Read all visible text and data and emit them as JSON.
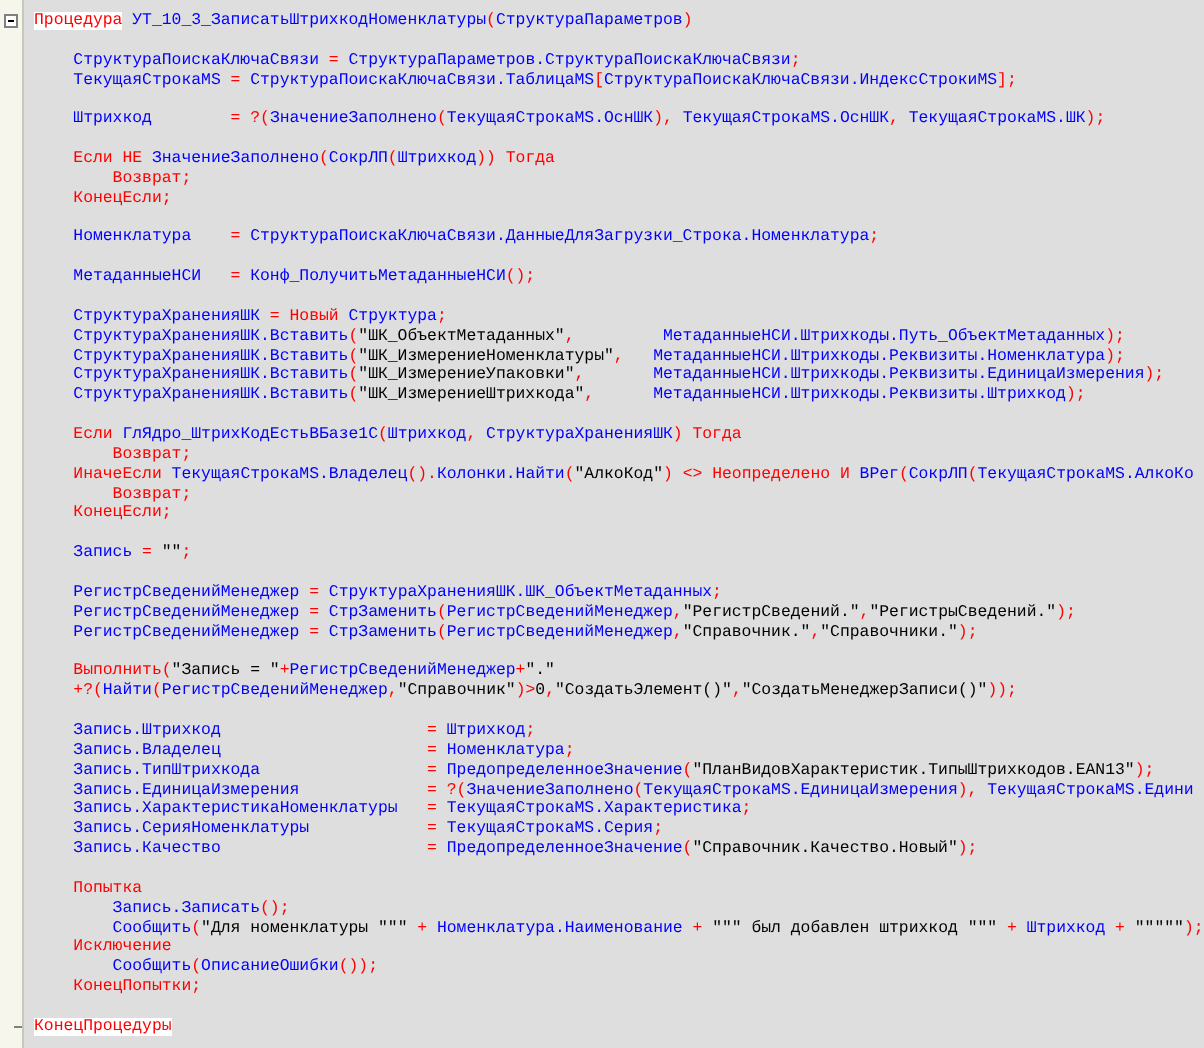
{
  "editor": {
    "lines": [
      {
        "kind": "procedure_start",
        "tokens": [
          {
            "kind": "marked_keyword",
            "text": "Процедура"
          },
          {
            "kind": "name",
            "text": " УТ_10_3_ЗаписатьШтрихкодНоменклатуры"
          },
          {
            "kind": "operator",
            "text": "("
          },
          {
            "kind": "name",
            "text": "СтруктураПараметров"
          },
          {
            "kind": "operator",
            "text": ")"
          }
        ]
      },
      {
        "kind": "blank"
      },
      {
        "kind": "code",
        "tokens": [
          {
            "kind": "name",
            "text": "    СтруктураПоискаКлючаСвязи"
          },
          {
            "kind": "operator",
            "text": " = "
          },
          {
            "kind": "name",
            "text": "СтруктураПараметров.СтруктураПоискаКлючаСвязи"
          },
          {
            "kind": "operator",
            "text": ";"
          }
        ]
      },
      {
        "kind": "code",
        "tokens": [
          {
            "kind": "name",
            "text": "    ТекущаяСтрокаMS"
          },
          {
            "kind": "operator",
            "text": " = "
          },
          {
            "kind": "name",
            "text": "СтруктураПоискаКлючаСвязи.ТаблицаMS"
          },
          {
            "kind": "operator",
            "text": "["
          },
          {
            "kind": "name",
            "text": "СтруктураПоискаКлючаСвязи.ИндексСтрокиMS"
          },
          {
            "kind": "operator",
            "text": "];"
          }
        ]
      },
      {
        "kind": "blank"
      },
      {
        "kind": "code",
        "tokens": [
          {
            "kind": "name",
            "text": "    Штрихкод"
          },
          {
            "kind": "operator",
            "text": "        = ?("
          },
          {
            "kind": "name",
            "text": "ЗначениеЗаполнено"
          },
          {
            "kind": "operator",
            "text": "("
          },
          {
            "kind": "name",
            "text": "ТекущаяСтрокаMS.ОснШК"
          },
          {
            "kind": "operator",
            "text": "), "
          },
          {
            "kind": "name",
            "text": "ТекущаяСтрокаMS.ОснШК"
          },
          {
            "kind": "operator",
            "text": ", "
          },
          {
            "kind": "name",
            "text": "ТекущаяСтрокаMS.ШК"
          },
          {
            "kind": "operator",
            "text": ");"
          }
        ]
      },
      {
        "kind": "blank"
      },
      {
        "kind": "code",
        "tokens": [
          {
            "kind": "keyword",
            "text": "    Если НЕ "
          },
          {
            "kind": "name",
            "text": "ЗначениеЗаполнено"
          },
          {
            "kind": "operator",
            "text": "("
          },
          {
            "kind": "name",
            "text": "СокрЛП"
          },
          {
            "kind": "operator",
            "text": "("
          },
          {
            "kind": "name",
            "text": "Штрихкод"
          },
          {
            "kind": "operator",
            "text": ")) "
          },
          {
            "kind": "keyword",
            "text": "Тогда"
          }
        ]
      },
      {
        "kind": "code",
        "tokens": [
          {
            "kind": "keyword",
            "text": "        Возврат;"
          }
        ]
      },
      {
        "kind": "code",
        "tokens": [
          {
            "kind": "keyword",
            "text": "    КонецЕсли;"
          }
        ]
      },
      {
        "kind": "blank"
      },
      {
        "kind": "code",
        "tokens": [
          {
            "kind": "name",
            "text": "    Номенклатура"
          },
          {
            "kind": "operator",
            "text": "    = "
          },
          {
            "kind": "name",
            "text": "СтруктураПоискаКлючаСвязи.ДанныеДляЗагрузки_Строка.Номенклатура"
          },
          {
            "kind": "operator",
            "text": ";"
          }
        ]
      },
      {
        "kind": "blank"
      },
      {
        "kind": "code",
        "tokens": [
          {
            "kind": "name",
            "text": "    МетаданныеНСИ"
          },
          {
            "kind": "operator",
            "text": "   = "
          },
          {
            "kind": "name",
            "text": "Конф_ПолучитьМетаданныеНСИ"
          },
          {
            "kind": "operator",
            "text": "();"
          }
        ]
      },
      {
        "kind": "blank"
      },
      {
        "kind": "code",
        "tokens": [
          {
            "kind": "name",
            "text": "    СтруктураХраненияШК"
          },
          {
            "kind": "operator",
            "text": " = "
          },
          {
            "kind": "keyword",
            "text": "Новый "
          },
          {
            "kind": "name",
            "text": "Структура"
          },
          {
            "kind": "operator",
            "text": ";"
          }
        ]
      },
      {
        "kind": "code",
        "tokens": [
          {
            "kind": "name",
            "text": "    СтруктураХраненияШК.Вставить"
          },
          {
            "kind": "operator",
            "text": "("
          },
          {
            "kind": "string",
            "text": "\"ШК_ОбъектМетаданных\""
          },
          {
            "kind": "operator",
            "text": ",         "
          },
          {
            "kind": "name",
            "text": "МетаданныеНСИ.Штрихкоды.Путь_ОбъектМетаданных"
          },
          {
            "kind": "operator",
            "text": ");"
          }
        ]
      },
      {
        "kind": "code",
        "tokens": [
          {
            "kind": "name",
            "text": "    СтруктураХраненияШК.Вставить"
          },
          {
            "kind": "operator",
            "text": "("
          },
          {
            "kind": "string",
            "text": "\"ШК_ИзмерениеНоменклатуры\""
          },
          {
            "kind": "operator",
            "text": ",   "
          },
          {
            "kind": "name",
            "text": "МетаданныеНСИ.Штрихкоды.Реквизиты.Номенклатура"
          },
          {
            "kind": "operator",
            "text": ");"
          }
        ]
      },
      {
        "kind": "code",
        "tokens": [
          {
            "kind": "name",
            "text": "    СтруктураХраненияШК.Вставить"
          },
          {
            "kind": "operator",
            "text": "("
          },
          {
            "kind": "string",
            "text": "\"ШК_ИзмерениеУпаковки\""
          },
          {
            "kind": "operator",
            "text": ",       "
          },
          {
            "kind": "name",
            "text": "МетаданныеНСИ.Штрихкоды.Реквизиты.ЕдиницаИзмерения"
          },
          {
            "kind": "operator",
            "text": ");"
          }
        ]
      },
      {
        "kind": "code",
        "tokens": [
          {
            "kind": "name",
            "text": "    СтруктураХраненияШК.Вставить"
          },
          {
            "kind": "operator",
            "text": "("
          },
          {
            "kind": "string",
            "text": "\"ШК_ИзмерениеШтрихкода\""
          },
          {
            "kind": "operator",
            "text": ",      "
          },
          {
            "kind": "name",
            "text": "МетаданныеНСИ.Штрихкоды.Реквизиты.Штрихкод"
          },
          {
            "kind": "operator",
            "text": ");"
          }
        ]
      },
      {
        "kind": "blank"
      },
      {
        "kind": "code",
        "tokens": [
          {
            "kind": "keyword",
            "text": "    Если "
          },
          {
            "kind": "name",
            "text": "ГлЯдро_ШтрихКодЕстьВБазе1С"
          },
          {
            "kind": "operator",
            "text": "("
          },
          {
            "kind": "name",
            "text": "Штрихкод"
          },
          {
            "kind": "operator",
            "text": ", "
          },
          {
            "kind": "name",
            "text": "СтруктураХраненияШК"
          },
          {
            "kind": "operator",
            "text": ") "
          },
          {
            "kind": "keyword",
            "text": "Тогда"
          }
        ]
      },
      {
        "kind": "code",
        "tokens": [
          {
            "kind": "keyword",
            "text": "        Возврат;"
          }
        ]
      },
      {
        "kind": "code",
        "tokens": [
          {
            "kind": "keyword",
            "text": "    ИначеЕсли "
          },
          {
            "kind": "name",
            "text": "ТекущаяСтрокаMS.Владелец"
          },
          {
            "kind": "operator",
            "text": "()."
          },
          {
            "kind": "name",
            "text": "Колонки.Найти"
          },
          {
            "kind": "operator",
            "text": "("
          },
          {
            "kind": "string",
            "text": "\"АлкоКод\""
          },
          {
            "kind": "operator",
            "text": ") <> "
          },
          {
            "kind": "keyword",
            "text": "Неопределено И "
          },
          {
            "kind": "name",
            "text": "ВРег"
          },
          {
            "kind": "operator",
            "text": "("
          },
          {
            "kind": "name",
            "text": "СокрЛП"
          },
          {
            "kind": "operator",
            "text": "("
          },
          {
            "kind": "name",
            "text": "ТекущаяСтрокаMS.АлкоКо"
          }
        ]
      },
      {
        "kind": "code",
        "tokens": [
          {
            "kind": "keyword",
            "text": "        Возврат;"
          }
        ]
      },
      {
        "kind": "code",
        "tokens": [
          {
            "kind": "keyword",
            "text": "    КонецЕсли;"
          }
        ]
      },
      {
        "kind": "blank"
      },
      {
        "kind": "code",
        "tokens": [
          {
            "kind": "name",
            "text": "    Запись"
          },
          {
            "kind": "operator",
            "text": " = "
          },
          {
            "kind": "string",
            "text": "\"\""
          },
          {
            "kind": "operator",
            "text": ";"
          }
        ]
      },
      {
        "kind": "blank"
      },
      {
        "kind": "code",
        "tokens": [
          {
            "kind": "name",
            "text": "    РегистрСведенийМенеджер"
          },
          {
            "kind": "operator",
            "text": " = "
          },
          {
            "kind": "name",
            "text": "СтруктураХраненияШК.ШК_ОбъектМетаданных"
          },
          {
            "kind": "operator",
            "text": ";"
          }
        ]
      },
      {
        "kind": "code",
        "tokens": [
          {
            "kind": "name",
            "text": "    РегистрСведенийМенеджер"
          },
          {
            "kind": "operator",
            "text": " = "
          },
          {
            "kind": "name",
            "text": "СтрЗаменить"
          },
          {
            "kind": "operator",
            "text": "("
          },
          {
            "kind": "name",
            "text": "РегистрСведенийМенеджер"
          },
          {
            "kind": "operator",
            "text": ","
          },
          {
            "kind": "string",
            "text": "\"РегистрСведений.\""
          },
          {
            "kind": "operator",
            "text": ","
          },
          {
            "kind": "string",
            "text": "\"РегистрыСведений.\""
          },
          {
            "kind": "operator",
            "text": ");"
          }
        ]
      },
      {
        "kind": "code",
        "tokens": [
          {
            "kind": "name",
            "text": "    РегистрСведенийМенеджер"
          },
          {
            "kind": "operator",
            "text": " = "
          },
          {
            "kind": "name",
            "text": "СтрЗаменить"
          },
          {
            "kind": "operator",
            "text": "("
          },
          {
            "kind": "name",
            "text": "РегистрСведенийМенеджер"
          },
          {
            "kind": "operator",
            "text": ","
          },
          {
            "kind": "string",
            "text": "\"Справочник.\""
          },
          {
            "kind": "operator",
            "text": ","
          },
          {
            "kind": "string",
            "text": "\"Справочники.\""
          },
          {
            "kind": "operator",
            "text": ");"
          }
        ]
      },
      {
        "kind": "blank"
      },
      {
        "kind": "code",
        "tokens": [
          {
            "kind": "keyword",
            "text": "    Выполнить"
          },
          {
            "kind": "operator",
            "text": "("
          },
          {
            "kind": "string",
            "text": "\"Запись = \""
          },
          {
            "kind": "operator",
            "text": "+"
          },
          {
            "kind": "name",
            "text": "РегистрСведенийМенеджер"
          },
          {
            "kind": "operator",
            "text": "+"
          },
          {
            "kind": "string",
            "text": "\".\""
          }
        ]
      },
      {
        "kind": "code",
        "tokens": [
          {
            "kind": "operator",
            "text": "    +?("
          },
          {
            "kind": "name",
            "text": "Найти"
          },
          {
            "kind": "operator",
            "text": "("
          },
          {
            "kind": "name",
            "text": "РегистрСведенийМенеджер"
          },
          {
            "kind": "operator",
            "text": ","
          },
          {
            "kind": "string",
            "text": "\"Справочник\""
          },
          {
            "kind": "operator",
            "text": ")>"
          },
          {
            "kind": "string",
            "text": "0"
          },
          {
            "kind": "operator",
            "text": ","
          },
          {
            "kind": "string",
            "text": "\"СоздатьЭлемент()\""
          },
          {
            "kind": "operator",
            "text": ","
          },
          {
            "kind": "string",
            "text": "\"СоздатьМенеджерЗаписи()\""
          },
          {
            "kind": "operator",
            "text": "));"
          }
        ]
      },
      {
        "kind": "blank"
      },
      {
        "kind": "code",
        "tokens": [
          {
            "kind": "name",
            "text": "    Запись.Штрихкод"
          },
          {
            "kind": "operator",
            "text": "                     = "
          },
          {
            "kind": "name",
            "text": "Штрихкод"
          },
          {
            "kind": "operator",
            "text": ";"
          }
        ]
      },
      {
        "kind": "code",
        "tokens": [
          {
            "kind": "name",
            "text": "    Запись.Владелец"
          },
          {
            "kind": "operator",
            "text": "                     = "
          },
          {
            "kind": "name",
            "text": "Номенклатура"
          },
          {
            "kind": "operator",
            "text": ";"
          }
        ]
      },
      {
        "kind": "code",
        "tokens": [
          {
            "kind": "name",
            "text": "    Запись.ТипШтрихкода"
          },
          {
            "kind": "operator",
            "text": "                 = "
          },
          {
            "kind": "name",
            "text": "ПредопределенноеЗначение"
          },
          {
            "kind": "operator",
            "text": "("
          },
          {
            "kind": "string",
            "text": "\"ПланВидовХарактеристик.ТипыШтрихкодов.EAN13\""
          },
          {
            "kind": "operator",
            "text": ");"
          }
        ]
      },
      {
        "kind": "code",
        "tokens": [
          {
            "kind": "name",
            "text": "    Запись.ЕдиницаИзмерения"
          },
          {
            "kind": "operator",
            "text": "             = ?("
          },
          {
            "kind": "name",
            "text": "ЗначениеЗаполнено"
          },
          {
            "kind": "operator",
            "text": "("
          },
          {
            "kind": "name",
            "text": "ТекущаяСтрокаMS.ЕдиницаИзмерения"
          },
          {
            "kind": "operator",
            "text": "), "
          },
          {
            "kind": "name",
            "text": "ТекущаяСтрокаMS.Едини"
          }
        ]
      },
      {
        "kind": "code",
        "tokens": [
          {
            "kind": "name",
            "text": "    Запись.ХарактеристикаНоменклатуры"
          },
          {
            "kind": "operator",
            "text": "   = "
          },
          {
            "kind": "name",
            "text": "ТекущаяСтрокаMS.Характеристика"
          },
          {
            "kind": "operator",
            "text": ";"
          }
        ]
      },
      {
        "kind": "code",
        "tokens": [
          {
            "kind": "name",
            "text": "    Запись.СерияНоменклатуры"
          },
          {
            "kind": "operator",
            "text": "            = "
          },
          {
            "kind": "name",
            "text": "ТекущаяСтрокаMS.Серия"
          },
          {
            "kind": "operator",
            "text": ";"
          }
        ]
      },
      {
        "kind": "code",
        "tokens": [
          {
            "kind": "name",
            "text": "    Запись.Качество"
          },
          {
            "kind": "operator",
            "text": "                     = "
          },
          {
            "kind": "name",
            "text": "ПредопределенноеЗначение"
          },
          {
            "kind": "operator",
            "text": "("
          },
          {
            "kind": "string",
            "text": "\"Справочник.Качество.Новый\""
          },
          {
            "kind": "operator",
            "text": ");"
          }
        ]
      },
      {
        "kind": "blank"
      },
      {
        "kind": "code",
        "tokens": [
          {
            "kind": "keyword",
            "text": "    Попытка"
          }
        ]
      },
      {
        "kind": "code",
        "tokens": [
          {
            "kind": "name",
            "text": "        Запись.Записать"
          },
          {
            "kind": "operator",
            "text": "();"
          }
        ]
      },
      {
        "kind": "code",
        "tokens": [
          {
            "kind": "name",
            "text": "        Сообщить"
          },
          {
            "kind": "operator",
            "text": "("
          },
          {
            "kind": "string",
            "text": "\"Для номенклатуры \"\"\""
          },
          {
            "kind": "operator",
            "text": " + "
          },
          {
            "kind": "name",
            "text": "Номенклатура.Наименование"
          },
          {
            "kind": "operator",
            "text": " + "
          },
          {
            "kind": "string",
            "text": "\"\"\" был добавлен штрихкод \"\"\""
          },
          {
            "kind": "operator",
            "text": " + "
          },
          {
            "kind": "name",
            "text": "Штрихкод"
          },
          {
            "kind": "operator",
            "text": " + "
          },
          {
            "kind": "string",
            "text": "\"\"\"\"\""
          },
          {
            "kind": "operator",
            "text": ");"
          }
        ]
      },
      {
        "kind": "code",
        "tokens": [
          {
            "kind": "keyword",
            "text": "    Исключение"
          }
        ]
      },
      {
        "kind": "code",
        "tokens": [
          {
            "kind": "name",
            "text": "        Сообщить"
          },
          {
            "kind": "operator",
            "text": "("
          },
          {
            "kind": "name",
            "text": "ОписаниеОшибки"
          },
          {
            "kind": "operator",
            "text": "());"
          }
        ]
      },
      {
        "kind": "code",
        "tokens": [
          {
            "kind": "keyword",
            "text": "    КонецПопытки;"
          }
        ]
      },
      {
        "kind": "blank"
      },
      {
        "kind": "procedure_end",
        "tokens": [
          {
            "kind": "marked_keyword",
            "text": "КонецПроцедуры"
          }
        ]
      }
    ]
  }
}
